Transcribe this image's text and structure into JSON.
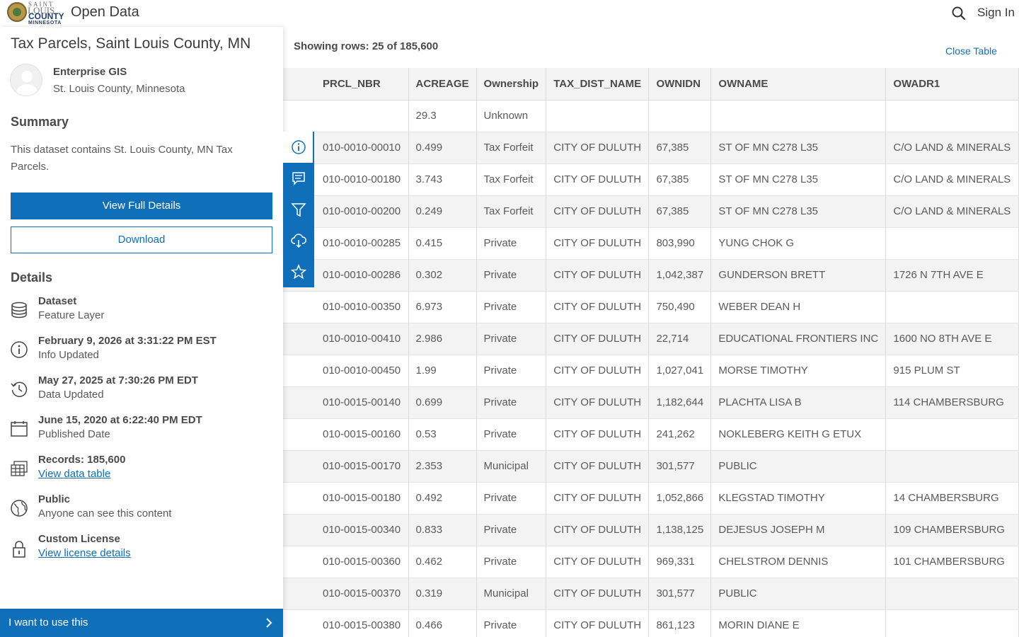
{
  "header": {
    "logo_line1": "SAINT",
    "logo_line2": "LOUIS",
    "logo_line3": "COUNTY",
    "logo_line4": "MINNESOTA",
    "site_title": "Open Data",
    "sign_in": "Sign In"
  },
  "dataset": {
    "title": "Tax Parcels, Saint Louis County, MN",
    "owner_name": "Enterprise GIS",
    "owner_org": "St. Louis County, Minnesota",
    "summary_heading": "Summary",
    "summary_text": "This dataset contains St. Louis County, MN Tax Parcels.",
    "view_full_details": "View Full Details",
    "download": "Download",
    "details_heading": "Details",
    "details": {
      "type_main": "Dataset",
      "type_sub": "Feature Layer",
      "info_main": "February 9, 2026 at 3:31:22 PM EST",
      "info_sub": "Info Updated",
      "data_main": "May 27, 2025 at 7:30:26 PM EDT",
      "data_sub": "Data Updated",
      "pub_main": "June 15, 2020 at 6:22:40 PM EDT",
      "pub_sub": "Published Date",
      "records_main": "Records: 185,600",
      "records_link": "View data table",
      "access_main": "Public",
      "access_sub": "Anyone can see this content",
      "license_main": "Custom License",
      "license_link": "View license details"
    },
    "use_bar": "I want to use this"
  },
  "toolbar": [
    "info-icon",
    "comment-icon",
    "filter-icon",
    "download-icon",
    "star-icon"
  ],
  "table": {
    "rows_label": "Showing rows: 25 of 185,600",
    "close_label": "Close Table",
    "columns": [
      "PRCL_NBR",
      "ACREAGE",
      "Ownership",
      "TAX_DIST_NAME",
      "OWNIDN",
      "OWNAME",
      "OWADR1"
    ],
    "rows": [
      [
        "",
        "29.3",
        "Unknown",
        "",
        "",
        "",
        ""
      ],
      [
        "010-0010-00010",
        "0.499",
        "Tax Forfeit",
        "CITY OF DULUTH",
        "67,385",
        "ST OF MN C278 L35",
        "C/O LAND & MINERALS"
      ],
      [
        "010-0010-00180",
        "3.743",
        "Tax Forfeit",
        "CITY OF DULUTH",
        "67,385",
        "ST OF MN C278 L35",
        "C/O LAND & MINERALS"
      ],
      [
        "010-0010-00200",
        "0.249",
        "Tax Forfeit",
        "CITY OF DULUTH",
        "67,385",
        "ST OF MN C278 L35",
        "C/O LAND & MINERALS"
      ],
      [
        "010-0010-00285",
        "0.415",
        "Private",
        "CITY OF DULUTH",
        "803,990",
        "YUNG CHOK G",
        ""
      ],
      [
        "010-0010-00286",
        "0.302",
        "Private",
        "CITY OF DULUTH",
        "1,042,387",
        "GUNDERSON BRETT",
        "1726 N 7TH AVE E"
      ],
      [
        "010-0010-00350",
        "6.973",
        "Private",
        "CITY OF DULUTH",
        "750,490",
        "WEBER DEAN H",
        ""
      ],
      [
        "010-0010-00410",
        "2.986",
        "Private",
        "CITY OF DULUTH",
        "22,714",
        "EDUCATIONAL FRONTIERS INC",
        "1600 NO 8TH AVE E"
      ],
      [
        "010-0010-00450",
        "1.99",
        "Private",
        "CITY OF DULUTH",
        "1,027,041",
        "MORSE TIMOTHY",
        "915 PLUM ST"
      ],
      [
        "010-0015-00140",
        "0.699",
        "Private",
        "CITY OF DULUTH",
        "1,182,644",
        "PLACHTA LISA B",
        "114 CHAMBERSBURG"
      ],
      [
        "010-0015-00160",
        "0.53",
        "Private",
        "CITY OF DULUTH",
        "241,262",
        "NOKLEBERG KEITH G ETUX",
        ""
      ],
      [
        "010-0015-00170",
        "2.353",
        "Municipal",
        "CITY OF DULUTH",
        "301,577",
        "PUBLIC",
        ""
      ],
      [
        "010-0015-00180",
        "0.492",
        "Private",
        "CITY OF DULUTH",
        "1,052,866",
        "KLEGSTAD TIMOTHY",
        "14 CHAMBERSBURG"
      ],
      [
        "010-0015-00340",
        "0.833",
        "Private",
        "CITY OF DULUTH",
        "1,138,125",
        "DEJESUS JOSEPH M",
        "109 CHAMBERSBURG"
      ],
      [
        "010-0015-00360",
        "0.462",
        "Private",
        "CITY OF DULUTH",
        "969,331",
        "CHELSTROM DENNIS",
        "101 CHAMBERSBURG"
      ],
      [
        "010-0015-00370",
        "0.319",
        "Municipal",
        "CITY OF DULUTH",
        "301,577",
        "PUBLIC",
        ""
      ],
      [
        "010-0015-00380",
        "0.466",
        "Private",
        "CITY OF DULUTH",
        "861,123",
        "MORIN DIANE E",
        ""
      ]
    ]
  },
  "colors": {
    "brand_blue": "#0f6fb8",
    "row_alt": "#f3f3f3",
    "text": "#4a4a4a"
  }
}
